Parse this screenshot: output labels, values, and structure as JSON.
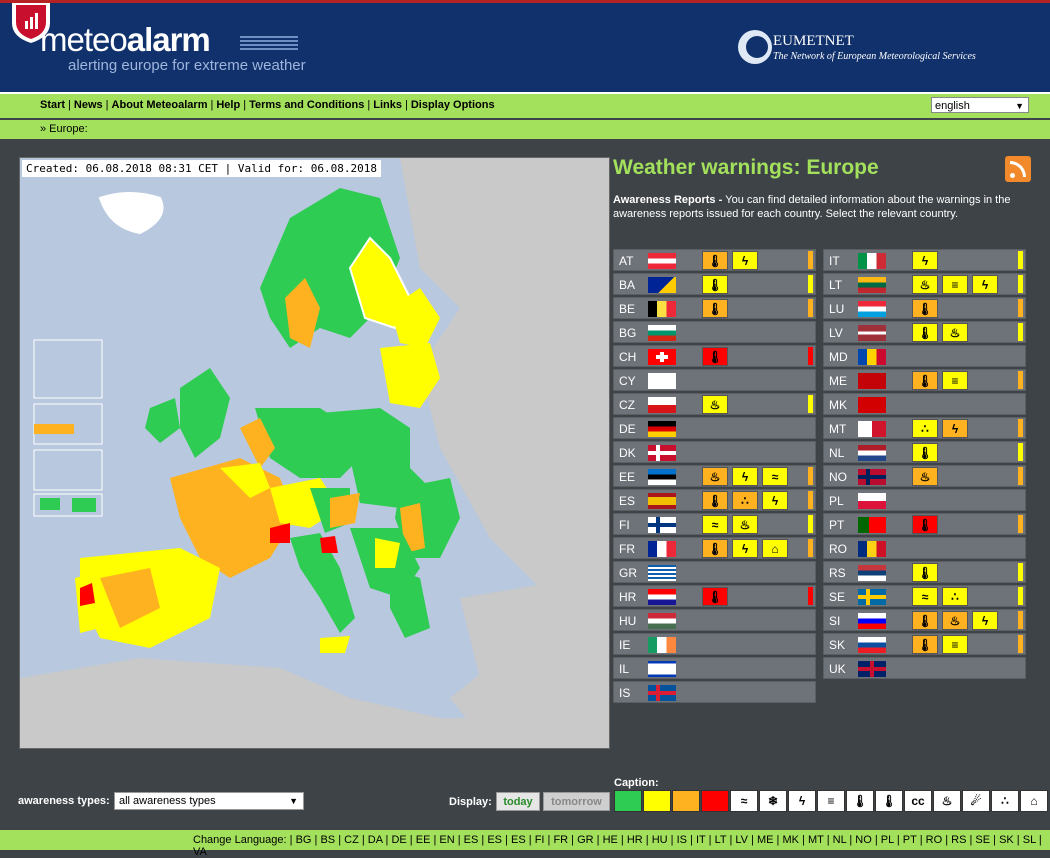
{
  "header": {
    "logo_main": "meteo",
    "logo_bold": "alarm",
    "tagline": "alerting europe for extreme weather",
    "partner_title": "EUMETNET",
    "partner_subtitle": "The Network of European Meteorological Services"
  },
  "nav": {
    "items": [
      "Start",
      "News",
      "About Meteoalarm",
      "Help",
      "Terms and Conditions",
      "Links",
      "Display Options"
    ],
    "language": "english"
  },
  "breadcrumb": "» Europe:",
  "map": {
    "created": "Created: 06.08.2018 08:31 CET | Valid for: 06.08.2018"
  },
  "page_title": "Weather warnings: Europe",
  "intro": {
    "bold": "Awareness Reports - ",
    "text": "You can find detailed information about the warnings in the awareness reports issued for each country. Select the relevant country."
  },
  "colors": {
    "green": "#2ecc52",
    "yellow": "#ffff00",
    "orange": "#ffb21f",
    "red": "#ff0000",
    "nav_green": "#a3e05c",
    "header_blue": "#10316b"
  },
  "countries_left": [
    {
      "code": "AT",
      "icons": [
        {
          "t": "🌡",
          "c": "orange"
        },
        {
          "t": "ϟ",
          "c": "yellow"
        }
      ],
      "level": "orange"
    },
    {
      "code": "BA",
      "icons": [
        {
          "t": "🌡",
          "c": "yellow"
        }
      ],
      "level": "yellow"
    },
    {
      "code": "BE",
      "icons": [
        {
          "t": "🌡",
          "c": "orange"
        }
      ],
      "level": "orange"
    },
    {
      "code": "BG",
      "icons": [],
      "level": ""
    },
    {
      "code": "CH",
      "icons": [
        {
          "t": "🌡",
          "c": "red"
        }
      ],
      "level": "red"
    },
    {
      "code": "CY",
      "icons": [],
      "level": ""
    },
    {
      "code": "CZ",
      "icons": [
        {
          "t": "♨",
          "c": "yellow"
        }
      ],
      "level": "yellow"
    },
    {
      "code": "DE",
      "icons": [],
      "level": ""
    },
    {
      "code": "DK",
      "icons": [],
      "level": ""
    },
    {
      "code": "EE",
      "icons": [
        {
          "t": "♨",
          "c": "orange"
        },
        {
          "t": "ϟ",
          "c": "yellow"
        },
        {
          "t": "≈",
          "c": "yellow"
        }
      ],
      "level": "orange"
    },
    {
      "code": "ES",
      "icons": [
        {
          "t": "🌡",
          "c": "orange"
        },
        {
          "t": "∴",
          "c": "orange"
        },
        {
          "t": "ϟ",
          "c": "yellow"
        }
      ],
      "level": "orange"
    },
    {
      "code": "FI",
      "icons": [
        {
          "t": "≈",
          "c": "yellow"
        },
        {
          "t": "♨",
          "c": "yellow"
        }
      ],
      "level": "yellow"
    },
    {
      "code": "FR",
      "icons": [
        {
          "t": "🌡",
          "c": "orange"
        },
        {
          "t": "ϟ",
          "c": "yellow"
        },
        {
          "t": "⌂",
          "c": "yellow"
        }
      ],
      "level": "orange"
    },
    {
      "code": "GR",
      "icons": [],
      "level": ""
    },
    {
      "code": "HR",
      "icons": [
        {
          "t": "🌡",
          "c": "red"
        }
      ],
      "level": "red"
    },
    {
      "code": "HU",
      "icons": [],
      "level": ""
    },
    {
      "code": "IE",
      "icons": [],
      "level": ""
    },
    {
      "code": "IL",
      "icons": [],
      "level": ""
    },
    {
      "code": "IS",
      "icons": [],
      "level": ""
    }
  ],
  "countries_right": [
    {
      "code": "IT",
      "icons": [
        {
          "t": "ϟ",
          "c": "yellow"
        }
      ],
      "level": "yellow"
    },
    {
      "code": "LT",
      "icons": [
        {
          "t": "♨",
          "c": "yellow"
        },
        {
          "t": "≡",
          "c": "yellow"
        },
        {
          "t": "ϟ",
          "c": "yellow"
        }
      ],
      "level": "yellow"
    },
    {
      "code": "LU",
      "icons": [
        {
          "t": "🌡",
          "c": "orange"
        }
      ],
      "level": "orange"
    },
    {
      "code": "LV",
      "icons": [
        {
          "t": "🌡",
          "c": "yellow"
        },
        {
          "t": "♨",
          "c": "yellow"
        }
      ],
      "level": "yellow"
    },
    {
      "code": "MD",
      "icons": [],
      "level": ""
    },
    {
      "code": "ME",
      "icons": [
        {
          "t": "🌡",
          "c": "orange"
        },
        {
          "t": "≡",
          "c": "yellow"
        }
      ],
      "level": "orange"
    },
    {
      "code": "MK",
      "icons": [],
      "level": ""
    },
    {
      "code": "MT",
      "icons": [
        {
          "t": "∴",
          "c": "yellow"
        },
        {
          "t": "ϟ",
          "c": "orange"
        }
      ],
      "level": "orange"
    },
    {
      "code": "NL",
      "icons": [
        {
          "t": "🌡",
          "c": "yellow"
        }
      ],
      "level": "yellow"
    },
    {
      "code": "NO",
      "icons": [
        {
          "t": "♨",
          "c": "orange"
        }
      ],
      "level": "orange"
    },
    {
      "code": "PL",
      "icons": [],
      "level": ""
    },
    {
      "code": "PT",
      "icons": [
        {
          "t": "🌡",
          "c": "red"
        }
      ],
      "level": "orange"
    },
    {
      "code": "RO",
      "icons": [],
      "level": ""
    },
    {
      "code": "RS",
      "icons": [
        {
          "t": "🌡",
          "c": "yellow"
        }
      ],
      "level": "yellow"
    },
    {
      "code": "SE",
      "icons": [
        {
          "t": "≈",
          "c": "yellow"
        },
        {
          "t": "∴",
          "c": "yellow"
        }
      ],
      "level": "yellow"
    },
    {
      "code": "SI",
      "icons": [
        {
          "t": "🌡",
          "c": "orange"
        },
        {
          "t": "♨",
          "c": "orange"
        },
        {
          "t": "ϟ",
          "c": "yellow"
        }
      ],
      "level": "orange"
    },
    {
      "code": "SK",
      "icons": [
        {
          "t": "🌡",
          "c": "orange"
        },
        {
          "t": "≡",
          "c": "yellow"
        }
      ],
      "level": "orange"
    },
    {
      "code": "UK",
      "icons": [],
      "level": ""
    }
  ],
  "bottom": {
    "types_label": "awareness types:",
    "types_value": "all awareness types",
    "display_label": "Display:",
    "today": "today",
    "tomorrow": "tomorrow",
    "caption_label": "Caption:",
    "caption_colors": [
      "green",
      "yellow",
      "orange",
      "red"
    ],
    "caption_icons": [
      "≈",
      "❄",
      "ϟ",
      "≡",
      "🌡",
      "🌡",
      "cc",
      "♨",
      "☄",
      "∴",
      "⌂"
    ]
  },
  "change_language": {
    "label": "Change Language:",
    "codes": [
      "BG",
      "BS",
      "CZ",
      "DA",
      "DE",
      "EE",
      "EN",
      "ES",
      "ES",
      "ES",
      "FI",
      "FR",
      "GR",
      "HE",
      "HR",
      "HU",
      "IS",
      "IT",
      "LT",
      "LV",
      "ME",
      "MK",
      "MT",
      "NL",
      "NO",
      "PL",
      "PT",
      "RO",
      "RS",
      "SE",
      "SK",
      "SL",
      "VA"
    ]
  }
}
